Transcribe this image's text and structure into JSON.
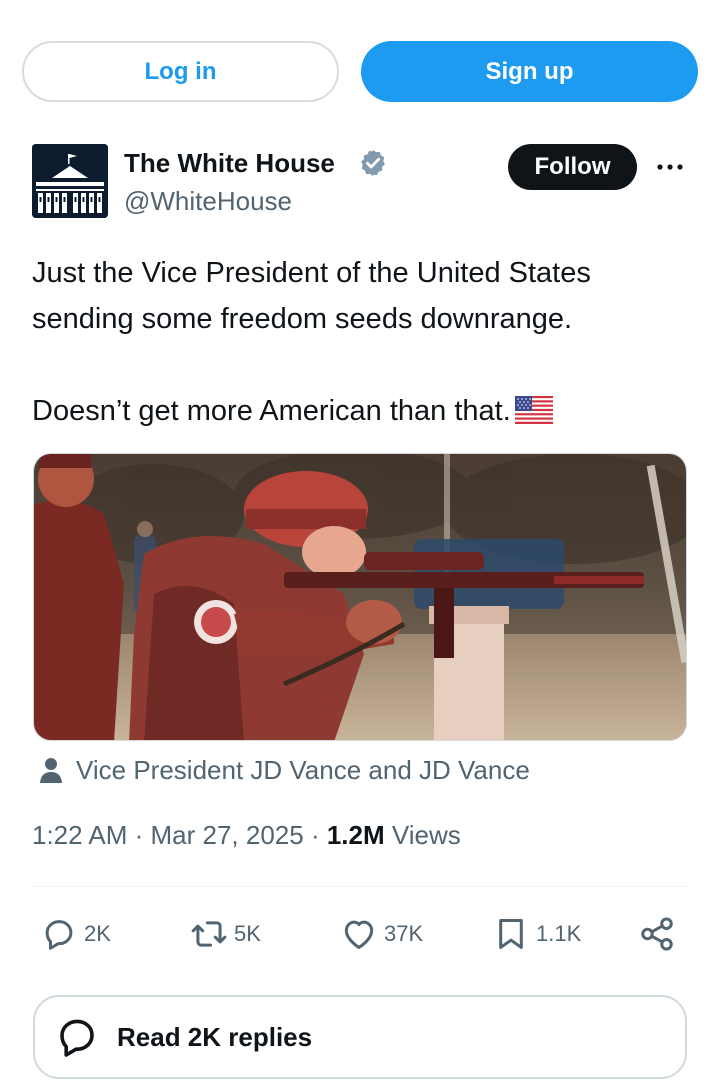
{
  "auth": {
    "login_label": "Log in",
    "signup_label": "Sign up"
  },
  "author": {
    "name": "The White House",
    "handle": "@WhiteHouse",
    "verified": true,
    "follow_label": "Follow",
    "more_icon": "more-horizontal-icon"
  },
  "tweet": {
    "line1": "Just the Vice President of the United States",
    "line2": "sending some freedom seeds downrange.",
    "line3": "Doesn’t get more American than that.",
    "emoji": "us-flag-icon"
  },
  "media": {
    "type": "photo",
    "tagged": "Vice President JD Vance and JD Vance"
  },
  "meta": {
    "time": "1:22 AM",
    "sep1": " · ",
    "date": "Mar 27, 2025",
    "sep2": " · ",
    "views_count": "1.2M",
    "views_label": " Views"
  },
  "actions": {
    "replies": "2K",
    "reposts": "5K",
    "likes": "37K",
    "bookmarks": "1.1K"
  },
  "read_replies_label": "Read 2K replies",
  "colors": {
    "accent": "#1d9bf0",
    "text": "#0f1419",
    "muted": "#536471",
    "border": "#cfd9de"
  }
}
